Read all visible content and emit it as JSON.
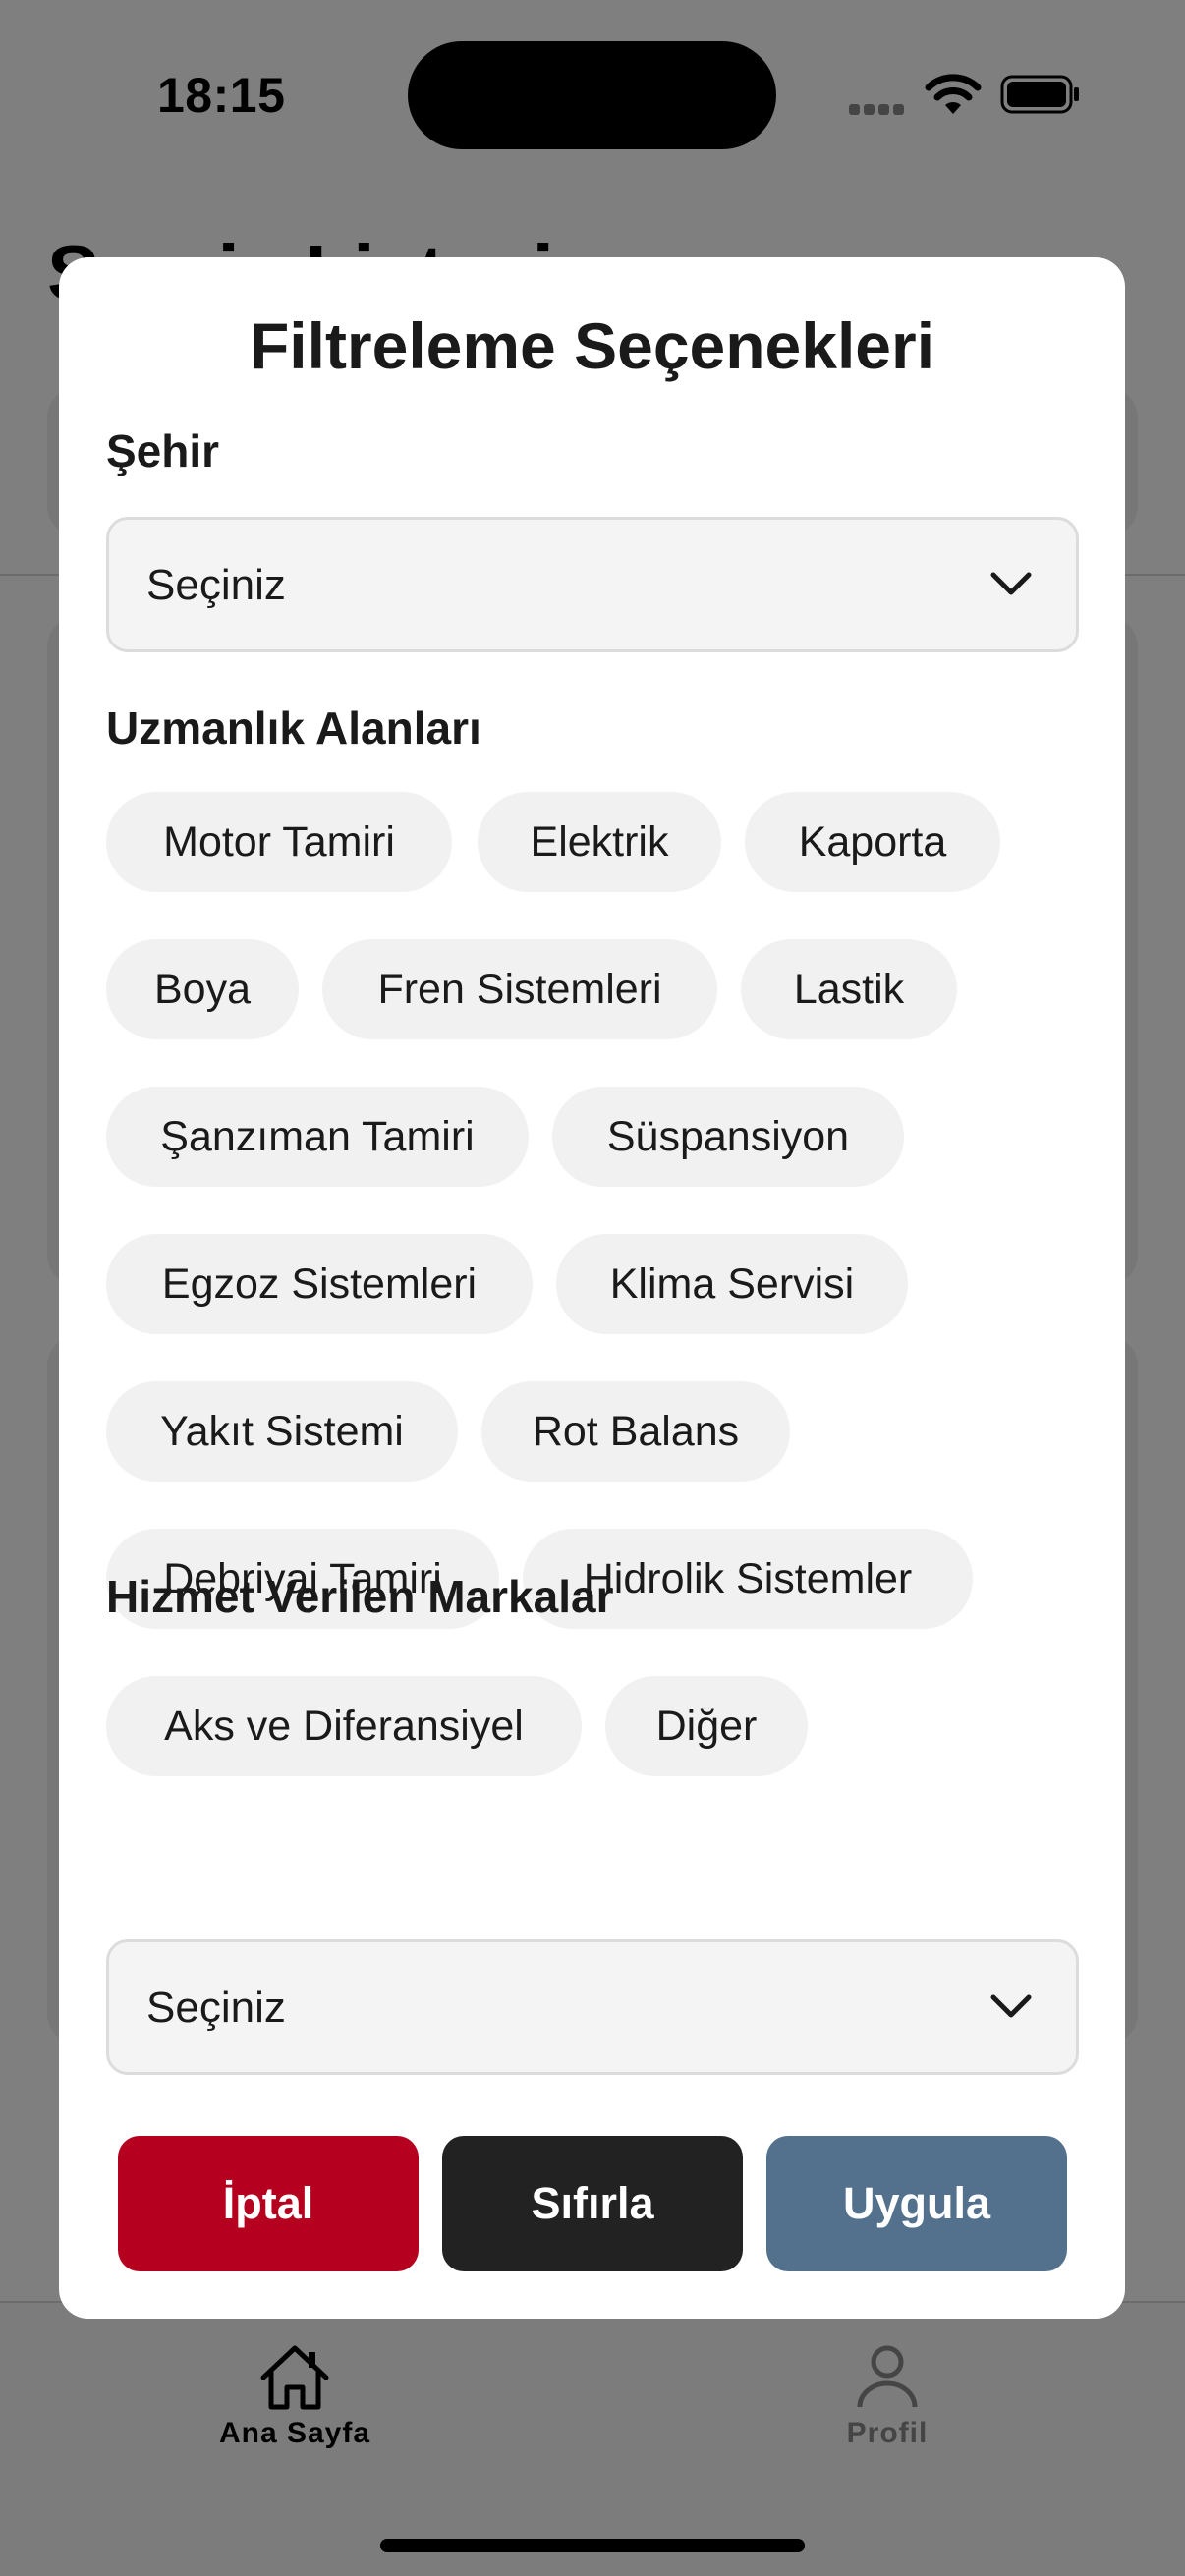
{
  "status_bar": {
    "time": "18:15"
  },
  "background": {
    "page_title": "Servis Listesi"
  },
  "tab_bar": {
    "tabs": [
      {
        "label": "Ana Sayfa",
        "icon": "home-icon",
        "active": true
      },
      {
        "label": "Profil",
        "icon": "person-icon",
        "active": false
      }
    ]
  },
  "filter_modal": {
    "title": "Filtreleme Seçenekleri",
    "city": {
      "label": "Şehir",
      "value": "Seçiniz"
    },
    "specialties": {
      "label": "Uzmanlık Alanları",
      "chips": [
        "Motor Tamiri",
        "Elektrik",
        "Kaporta",
        "Boya",
        "Fren Sistemleri",
        "Lastik",
        "Şanzıman Tamiri",
        "Süspansiyon",
        "Egzoz Sistemleri",
        "Klima Servisi",
        "Yakıt Sistemi",
        "Rot Balans",
        "Debriyaj Tamiri",
        "Hidrolik Sistemler",
        "Aks ve Diferansiyel",
        "Diğer"
      ]
    },
    "brands": {
      "label": "Hizmet Verilen Markalar",
      "value": "Seçiniz"
    },
    "buttons": {
      "cancel": "İptal",
      "reset": "Sıfırla",
      "apply": "Uygula"
    }
  },
  "colors": {
    "cancel": "#b5001f",
    "reset": "#222222",
    "apply": "#53708c",
    "chip_bg": "#f1f1f1"
  }
}
